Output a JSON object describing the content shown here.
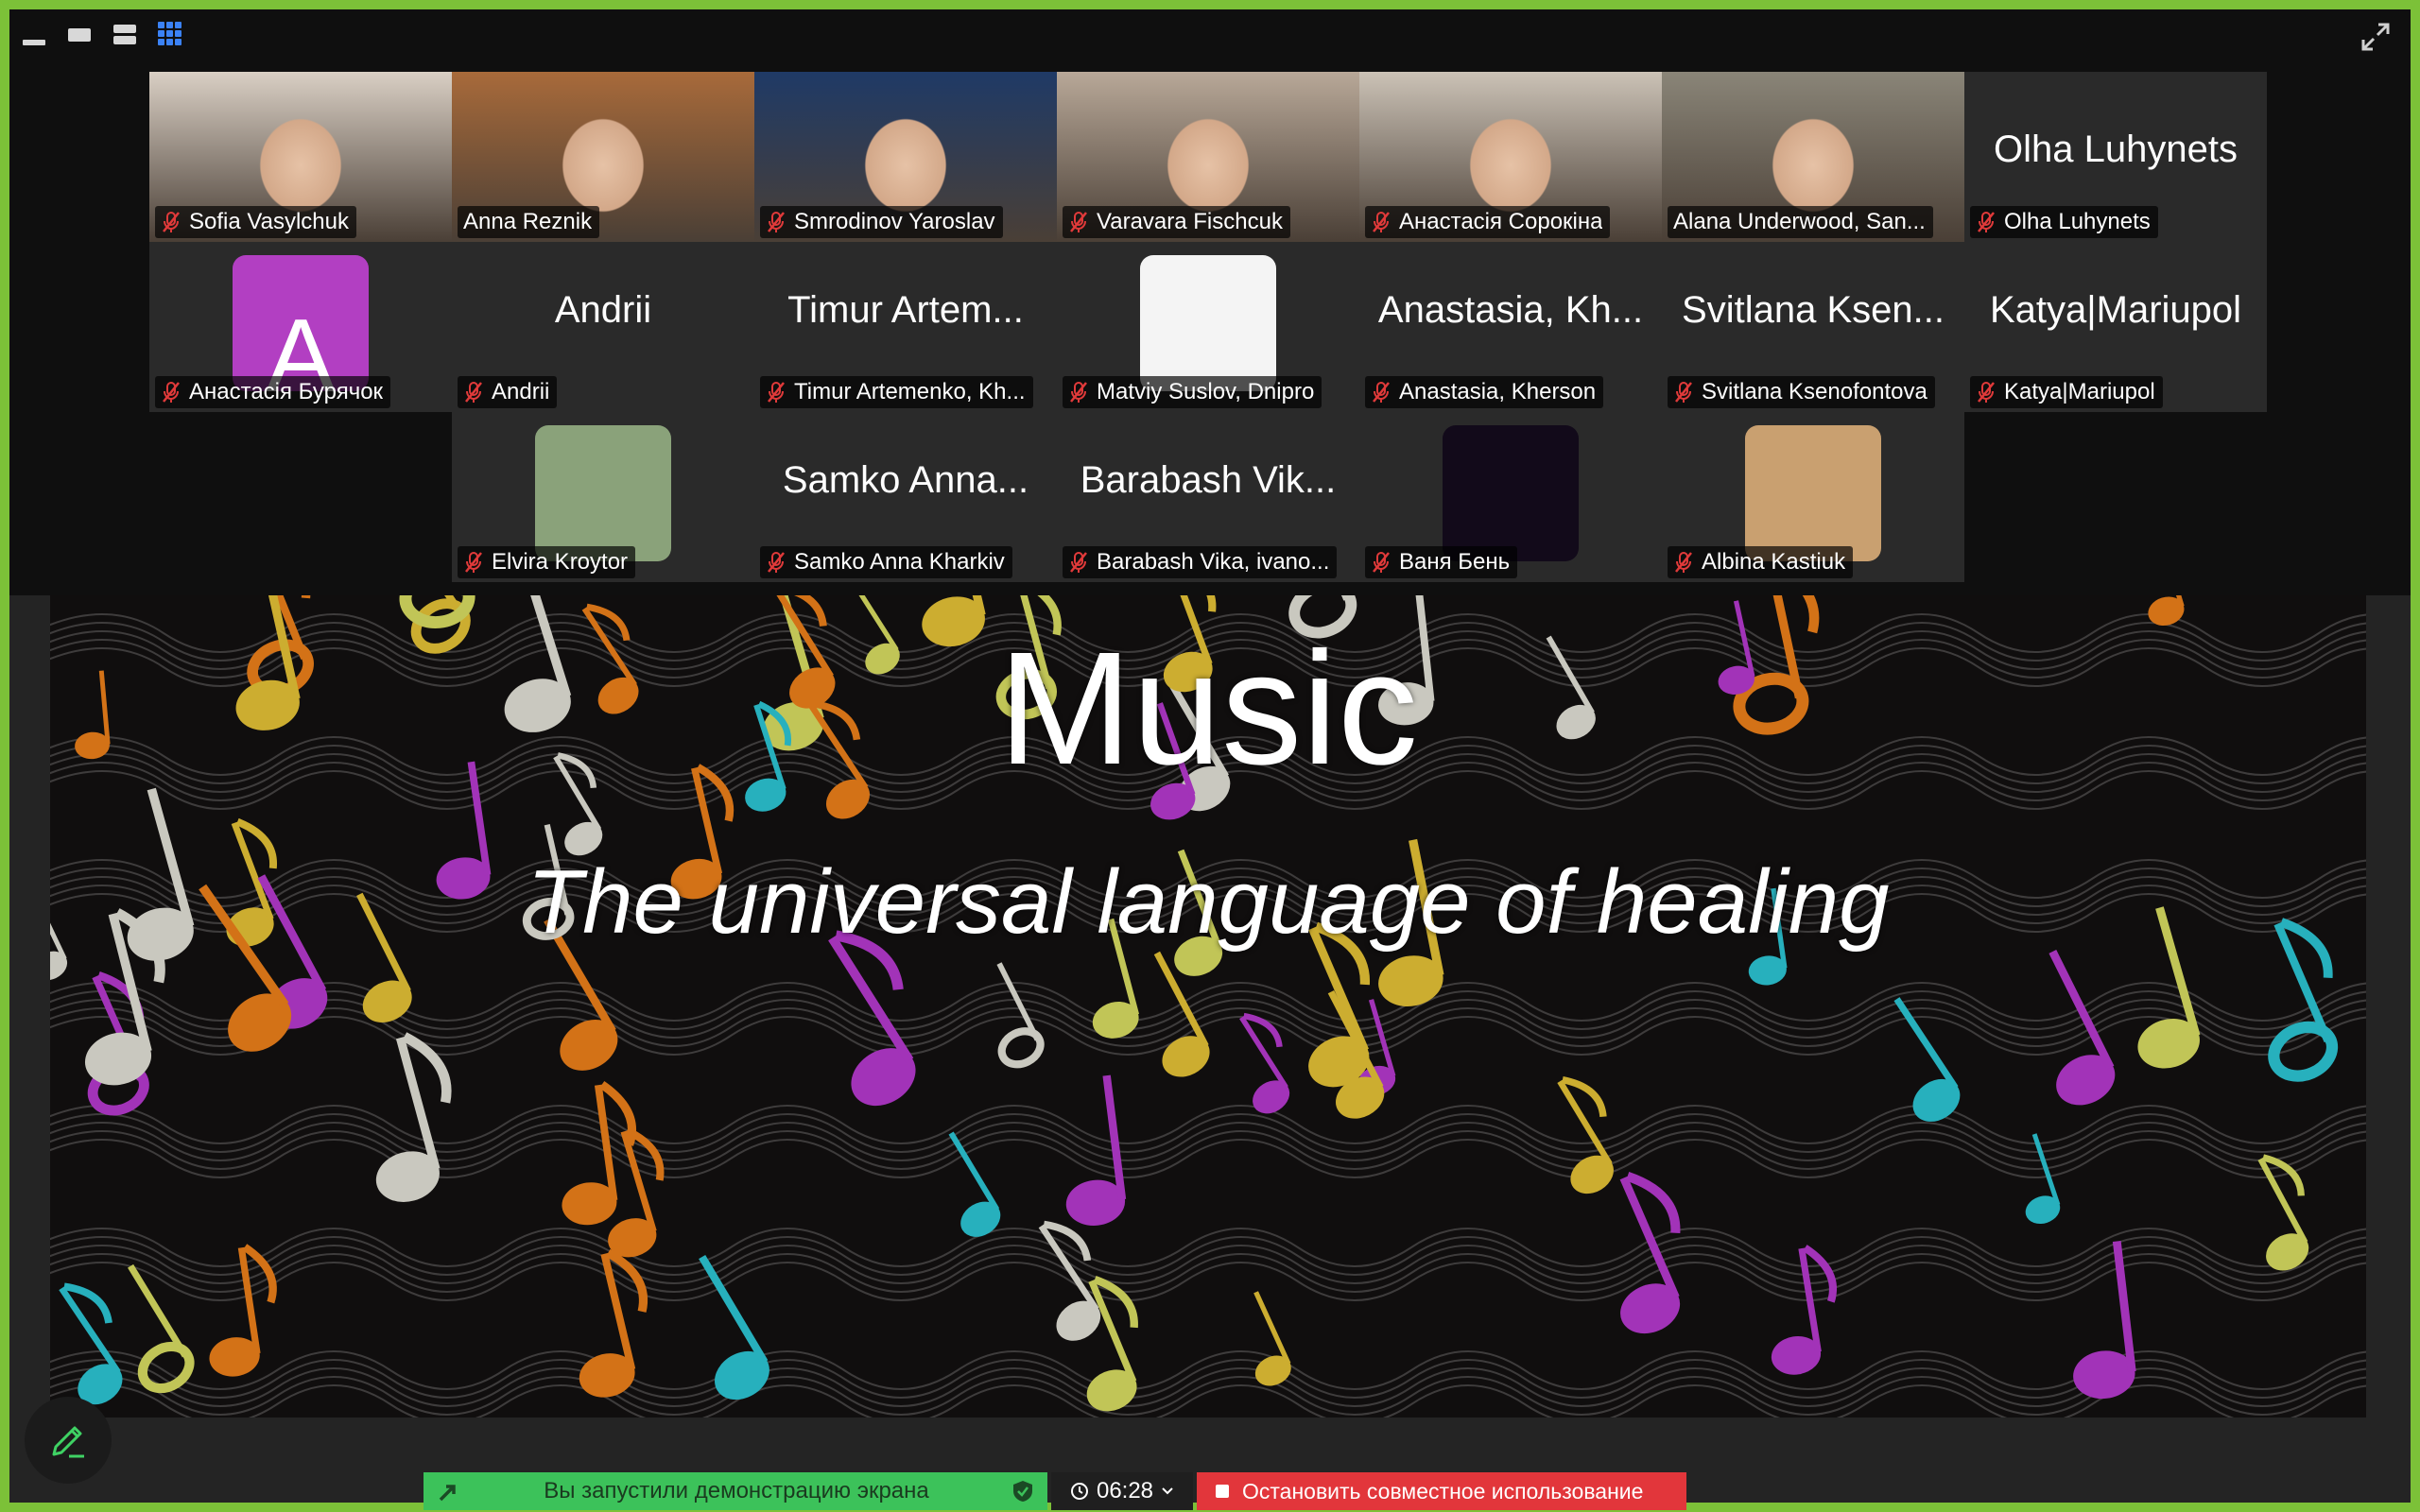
{
  "slide": {
    "title": "Music",
    "subtitle": "The universal language of healing"
  },
  "participants": [
    {
      "name": "Sofia Vasylchuk",
      "display": "",
      "kind": "video",
      "bg": "#d9cfc4",
      "muted": true
    },
    {
      "name": "Anna Reznik",
      "display": "",
      "kind": "video",
      "bg": "#a86a3a",
      "muted": false
    },
    {
      "name": "Smrodinov Yaroslav",
      "display": "",
      "kind": "video",
      "bg": "#1f3a66",
      "muted": true
    },
    {
      "name": "Varavara Fischcuk",
      "display": "",
      "kind": "video",
      "bg": "#b8a898",
      "muted": true
    },
    {
      "name": "Анастасія Сорокіна",
      "display": "",
      "kind": "video",
      "bg": "#cbc2b6",
      "muted": true
    },
    {
      "name": "Alana Underwood, San...",
      "display": "",
      "kind": "video",
      "bg": "#8a8578",
      "muted": false,
      "active": true
    },
    {
      "name": "Olha Luhynets",
      "display": "Olha Luhynets",
      "kind": "name",
      "muted": true
    },
    {
      "name": "Анастасія Бурячок",
      "display": "A",
      "kind": "avatar",
      "bg": "#b23fc2",
      "muted": true
    },
    {
      "name": "Andrii",
      "display": "Andrii",
      "kind": "name",
      "muted": true
    },
    {
      "name": "Timur Artemenko, Kh...",
      "display": "Timur Artem...",
      "kind": "name",
      "muted": true
    },
    {
      "name": "Matviy Suslov, Dnipro",
      "display": "",
      "kind": "avatar",
      "bg": "#f4f4f4",
      "muted": true
    },
    {
      "name": "Anastasia, Kherson",
      "display": "Anastasia, Kh...",
      "kind": "name",
      "muted": true
    },
    {
      "name": "Svitlana Ksenofontova",
      "display": "Svitlana Ksen...",
      "kind": "name",
      "muted": true
    },
    {
      "name": "Katya|Mariupol",
      "display": "Katya|Mariupol",
      "kind": "name",
      "muted": true
    },
    {
      "name": "Elvira Kroytor",
      "display": "",
      "kind": "avatar",
      "bg": "#8aa27a",
      "muted": true
    },
    {
      "name": "Samko Anna Kharkiv",
      "display": "Samko Anna...",
      "kind": "name",
      "muted": true
    },
    {
      "name": "Barabash Vika, ivano...",
      "display": "Barabash Vik...",
      "kind": "name",
      "muted": true
    },
    {
      "name": "Ваня Бень",
      "display": "",
      "kind": "avatar",
      "bg": "#120a1a",
      "muted": true
    },
    {
      "name": "Albina Kastiuk",
      "display": "",
      "kind": "avatar",
      "bg": "#c9a070",
      "muted": true
    }
  ],
  "share_bar": {
    "status": "Вы запустили демонстрацию экрана",
    "timer": "06:28",
    "stop": "Остановить совместное использование"
  },
  "colors": {
    "frame": "#7cc138",
    "active_speaker": "#32d35a",
    "share_green": "#3cc25a",
    "stop_red": "#e2363b",
    "grid_icon": "#3b82f6",
    "muted_mic": "#e03a3a"
  }
}
